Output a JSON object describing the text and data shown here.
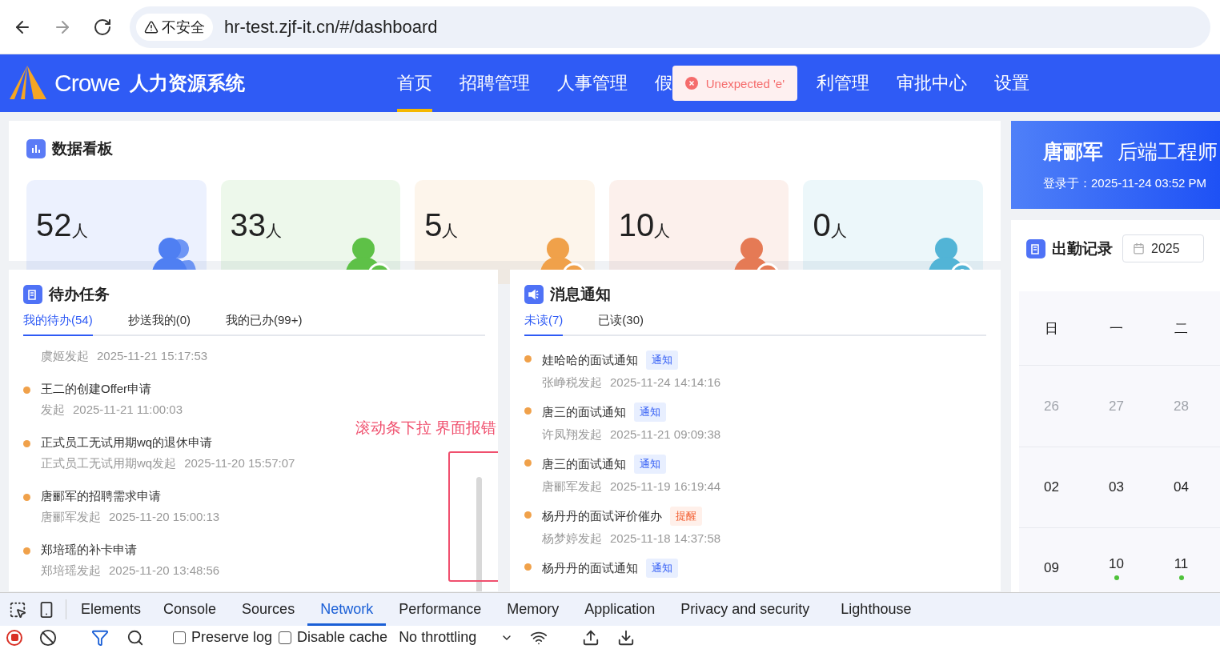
{
  "browser": {
    "nav_buttons": [
      {
        "kind": "back",
        "disabled": false
      },
      {
        "kind": "forward",
        "disabled": true
      },
      {
        "kind": "reload",
        "disabled": false
      }
    ],
    "security_chip": "不安全",
    "url": "hr-test.zjf-it.cn/#/dashboard"
  },
  "header": {
    "brand": "Crowe",
    "system_name": "人力资源系统",
    "nav": [
      {
        "label": "首页",
        "selected": true
      },
      {
        "label": "招聘管理",
        "selected": false
      },
      {
        "label": "人事管理",
        "selected": false
      },
      {
        "label": "假",
        "selected": false
      },
      {
        "label": "利管理",
        "selected": false
      },
      {
        "label": "审批中心",
        "selected": false
      },
      {
        "label": "设置",
        "selected": false
      }
    ],
    "toast": {
      "message": "Unexpected 'e'"
    }
  },
  "dashboard": {
    "title": "数据看板",
    "stats": [
      {
        "value": "52",
        "unit": "人",
        "kind": "group",
        "color": "#4f7ff2"
      },
      {
        "value": "33",
        "unit": "人",
        "kind": "joined",
        "color": "#5ec147"
      },
      {
        "value": "5",
        "unit": "人",
        "kind": "left",
        "color": "#f0a14a"
      },
      {
        "value": "10",
        "unit": "人",
        "kind": "transfer",
        "color": "#e57a55"
      },
      {
        "value": "0",
        "unit": "人",
        "kind": "regular",
        "color": "#52b4d6"
      }
    ]
  },
  "todo": {
    "title": "待办任务",
    "tabs": [
      {
        "label": "我的待办(54)",
        "selected": true
      },
      {
        "label": "抄送我的(0)",
        "selected": false
      },
      {
        "label": "我的已办(99+)",
        "selected": false
      }
    ],
    "items": [
      {
        "from": "虞姬发起",
        "time": "2025-11-21 15:17:53"
      },
      {
        "title": "王二的创建Offer申请",
        "from": "发起",
        "time": "2025-11-21 11:00:03"
      },
      {
        "title": "正式员工无试用期wq的退休申请",
        "from": "正式员工无试用期wq发起",
        "time": "2025-11-20 15:57:07"
      },
      {
        "title": "唐郦军的招聘需求申请",
        "from": "唐郦军发起",
        "time": "2025-11-20 15:00:13"
      },
      {
        "title": "郑培瑶的补卡申请",
        "from": "郑培瑶发起",
        "time": "2025-11-20 13:48:56"
      }
    ],
    "annotation": "滚动条下拉 界面报错"
  },
  "notices": {
    "title": "消息通知",
    "tabs": [
      {
        "label": "未读(7)",
        "selected": true
      },
      {
        "label": "已读(30)",
        "selected": false
      }
    ],
    "items": [
      {
        "title": "娃哈哈的面试通知",
        "tag": {
          "label": "通知",
          "kind": "notice"
        },
        "from": "张峥税发起",
        "time": "2025-11-24 14:14:16"
      },
      {
        "title": "唐三的面试通知",
        "tag": {
          "label": "通知",
          "kind": "notice"
        },
        "from": "许凤翔发起",
        "time": "2025-11-21 09:09:38"
      },
      {
        "title": "唐三的面试通知",
        "tag": {
          "label": "通知",
          "kind": "notice"
        },
        "from": "唐郦军发起",
        "time": "2025-11-19 16:19:44"
      },
      {
        "title": "杨丹丹的面试评价催办",
        "tag": {
          "label": "提醒",
          "kind": "reminder"
        },
        "from": "杨梦婷发起",
        "time": "2025-11-18 14:37:58"
      },
      {
        "title": "杨丹丹的面试通知",
        "tag": {
          "label": "通知",
          "kind": "notice"
        }
      }
    ]
  },
  "user": {
    "name": "唐郦军",
    "position": "后端工程师",
    "login": "登录于：2025-11-24 03:52 PM"
  },
  "attendance": {
    "title": "出勤记录",
    "year": "2025",
    "weekdays": [
      "日",
      "一",
      "二"
    ],
    "weeks": [
      [
        {
          "day": "26",
          "muted": true,
          "record": false
        },
        {
          "day": "27",
          "muted": true,
          "record": false
        },
        {
          "day": "28",
          "muted": true,
          "record": false
        }
      ],
      [
        {
          "day": "02",
          "muted": false,
          "record": false
        },
        {
          "day": "03",
          "muted": false,
          "record": false
        },
        {
          "day": "04",
          "muted": false,
          "record": false
        }
      ],
      [
        {
          "day": "09",
          "muted": false,
          "record": false
        },
        {
          "day": "10",
          "muted": false,
          "record": true
        },
        {
          "day": "11",
          "muted": false,
          "record": true
        }
      ]
    ]
  },
  "devtools": {
    "tabs": [
      {
        "label": "Elements",
        "selected": false
      },
      {
        "label": "Console",
        "selected": false
      },
      {
        "label": "Sources",
        "selected": false
      },
      {
        "label": "Network",
        "selected": true
      },
      {
        "label": "Performance",
        "selected": false
      },
      {
        "label": "Memory",
        "selected": false
      },
      {
        "label": "Application",
        "selected": false
      },
      {
        "label": "Privacy and security",
        "selected": false
      },
      {
        "label": "Lighthouse",
        "selected": false
      }
    ],
    "checkboxes": [
      {
        "label": "Preserve log",
        "checked": false
      },
      {
        "label": "Disable cache",
        "checked": false
      }
    ],
    "throttling": "No throttling"
  }
}
